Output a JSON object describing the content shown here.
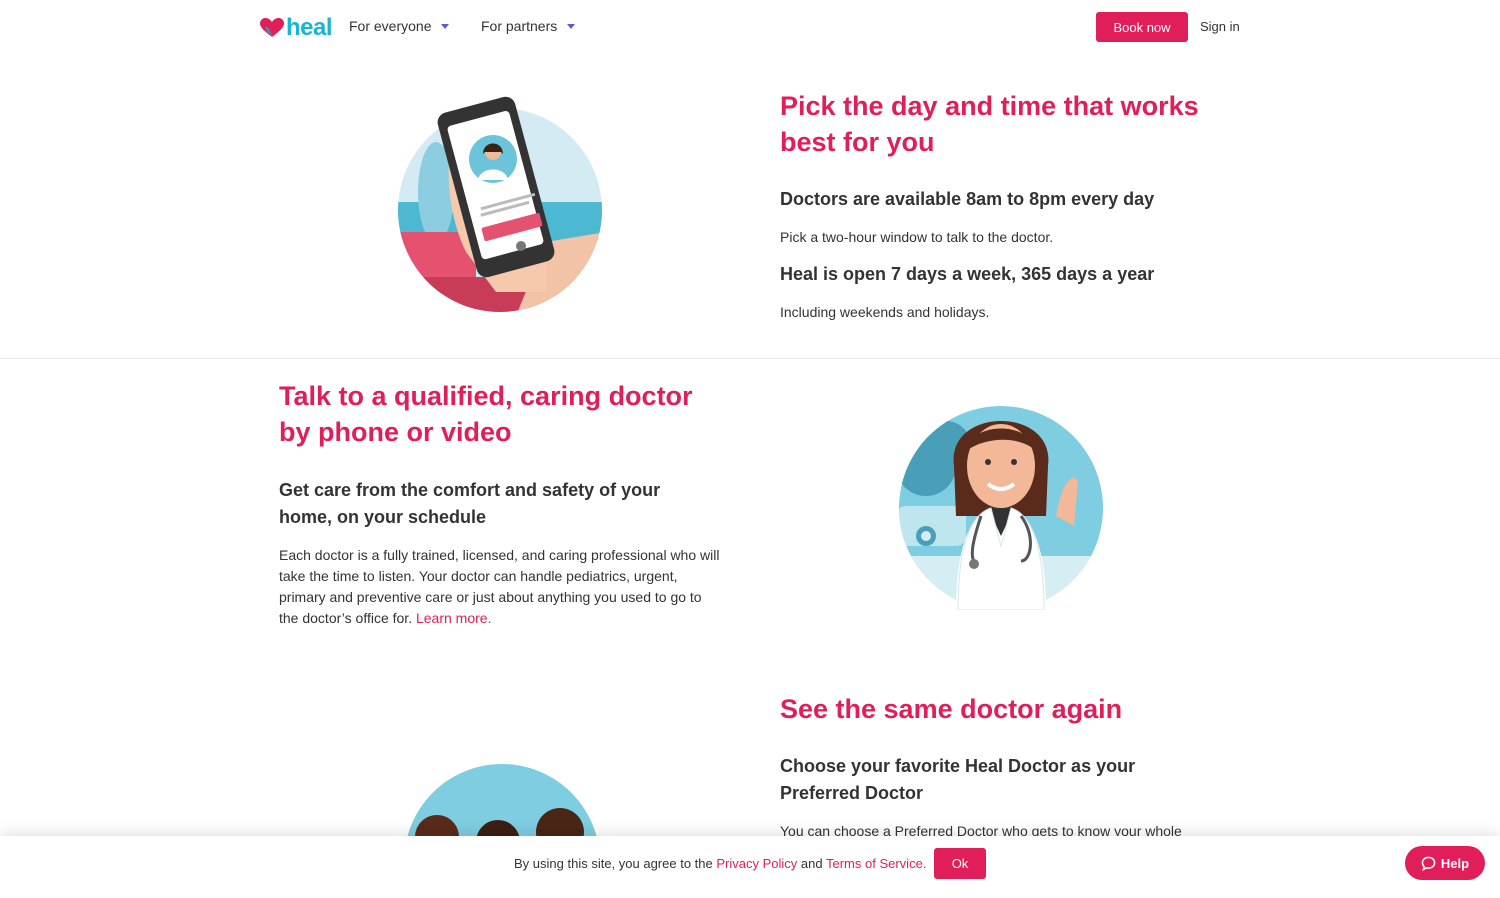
{
  "header": {
    "logo_text": "heal",
    "nav": [
      {
        "label": "For everyone"
      },
      {
        "label": "For partners"
      }
    ],
    "book_label": "Book now",
    "signin_label": "Sign in"
  },
  "section1": {
    "title": "Pick the day and time that works best for you",
    "sub1": "Doctors are available 8am to 8pm every day",
    "p1": "Pick a two-hour window to talk to the doctor.",
    "sub2": "Heal is open 7 days a week, 365 days a year",
    "p2": "Including weekends and holidays."
  },
  "section2": {
    "title": "Talk to a qualified, caring doctor by phone or video",
    "sub": "Get care from the comfort and safety of your home, on your schedule",
    "p": "Each doctor is a fully trained, licensed, and caring professional who will take the time to listen. Your doctor can handle pediatrics, urgent, primary and preventive care or just about anything you used to go to the doctor’s office for.",
    "link": "Learn more."
  },
  "section3": {
    "title": "See the same doctor again",
    "sub": "Choose your favorite Heal Doctor as your Preferred Doctor",
    "p": "You can choose a Preferred Doctor who gets to know your whole"
  },
  "cookie": {
    "text_before": "By using this site, you agree to the",
    "privacy_link": "Privacy Policy",
    "and": "and",
    "terms_link": "Terms of Service.",
    "ok_label": "Ok"
  },
  "help": {
    "label": "Help"
  },
  "colors": {
    "brand_pink": "#e01e5a",
    "brand_teal": "#17b5cf"
  }
}
